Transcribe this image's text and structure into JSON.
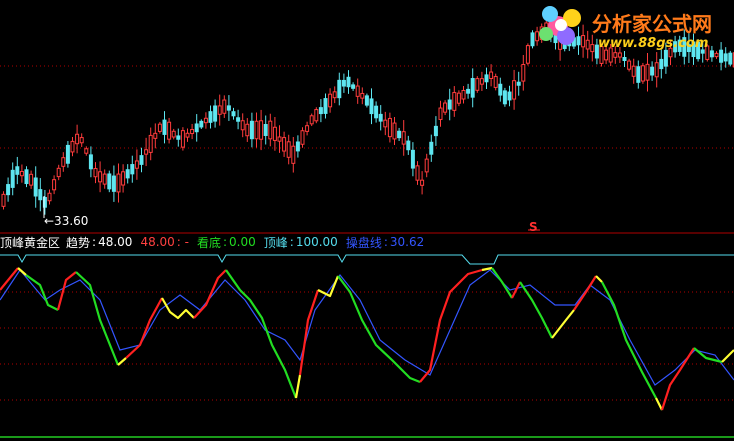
{
  "chart_data": [
    {
      "type": "candlestick",
      "annotations": {
        "low_marker": "←33.60",
        "signal_marker": "S"
      },
      "colors": {
        "up": "#ff3c3c",
        "down": "#5ee6f0"
      }
    },
    {
      "type": "line",
      "title": "顶峰黄金区",
      "ylim": [
        0,
        100
      ],
      "series": [
        {
          "name": "趋势",
          "value": "48.00",
          "color": "#ffffff"
        },
        {
          "name": "看底",
          "value": "0.00",
          "color": "#22dd22"
        },
        {
          "name": "顶峰",
          "value": "100.00",
          "color": "#55ddee"
        },
        {
          "name": "操盘线",
          "value": "30.62",
          "color": "#3355ff"
        }
      ],
      "extra": {
        "trend_value_2": "48.00",
        "sep": ": -"
      }
    }
  ],
  "logo": {
    "name": "分析家公式网",
    "url": "www.88gs.com"
  }
}
